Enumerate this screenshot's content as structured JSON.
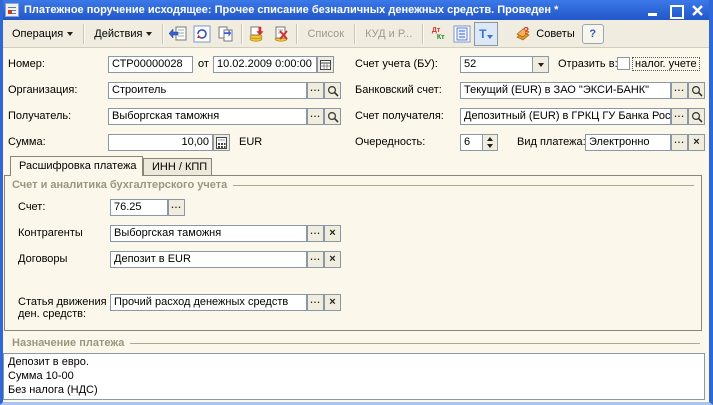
{
  "window": {
    "title": "Платежное поручение исходящее: Прочее списание безналичных денежных средств. Проведен *"
  },
  "toolbar": {
    "operation_label": "Операция",
    "actions_label": "Действия",
    "list_label": "Список",
    "kud_label": "КУД и Р...",
    "dt_label": "Дт",
    "kt_label": "Кт",
    "t_label": "Т",
    "tips_label": "Советы",
    "help_label": "?"
  },
  "fields": {
    "number": {
      "label": "Номер:",
      "value": "СТР00000028"
    },
    "date": {
      "label": "от",
      "value": "10.02.2009 0:00:00"
    },
    "organization": {
      "label": "Организация:",
      "value": "Строитель"
    },
    "payee": {
      "label": "Получатель:",
      "value": "Выборгская таможня"
    },
    "amount": {
      "label": "Сумма:",
      "value": "10,00",
      "currency": "EUR"
    },
    "account_bu": {
      "label": "Счет учета (БУ):",
      "value": "52"
    },
    "reflect": {
      "label": "Отразить в:",
      "checkbox_label": "налог. учете",
      "checked": false
    },
    "bank_account": {
      "label": "Банковский счет:",
      "value": "Текущий (EUR) в ЗАО \"ЭКСИ-БАНК\""
    },
    "payee_account": {
      "label": "Счет получателя:",
      "value": "Депозитный (EUR) в ГРКЦ ГУ Банка Рос"
    },
    "priority": {
      "label": "Очередность:",
      "value": "6"
    },
    "payment_kind": {
      "label": "Вид платежа:",
      "value": "Электронно"
    }
  },
  "tabs": [
    {
      "label": "Расшифровка платежа"
    },
    {
      "label": "ИНН / КПП"
    }
  ],
  "analytics": {
    "header": "Счет и аналитика бухгалтерского учета",
    "account": {
      "label": "Счет:",
      "value": "76.25"
    },
    "contractors": {
      "label": "Контрагенты",
      "value": "Выборгская таможня"
    },
    "contracts": {
      "label": "Договоры",
      "value": "Депозит в EUR"
    },
    "cashflow": {
      "label_line1": "Статья движения",
      "label_line2": "ден. средств:",
      "value": "Прочий расход денежных средств"
    }
  },
  "purpose": {
    "header": "Назначение платежа",
    "lines": [
      "Депозит в евро.",
      "Сумма 10-00",
      "Без налога (НДС)"
    ]
  }
}
